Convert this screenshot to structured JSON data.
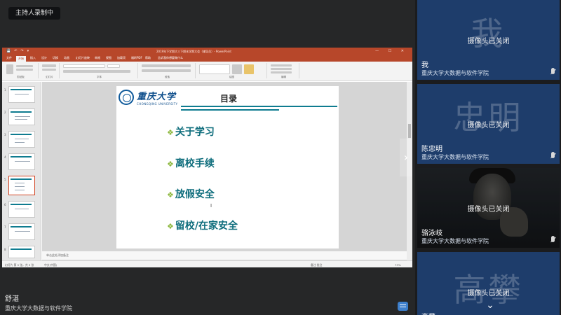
{
  "stage": {
    "recording_badge": "主持人录制中",
    "speaker_name": "舒湛",
    "speaker_org": "重庆大学大数据与软件学院"
  },
  "ppt": {
    "window_title": "2019年下学期大三下期末学期大会（辅导员）- PowerPoint",
    "window_controls": "— ☐ ✕",
    "menu_tabs": [
      "文件",
      "开始",
      "插入",
      "设计",
      "切换",
      "动画",
      "幻灯片放映",
      "审阅",
      "视图",
      "加载项",
      "福昕PDF",
      "帮助",
      "告诉我你想要做什么"
    ],
    "ribbon_groups": [
      "剪贴板",
      "幻灯片",
      "字体",
      "段落",
      "绘图",
      "编辑"
    ],
    "notes_placeholder": "单击此处添加备注",
    "status_left": "幻灯片 第 5 张，共 9 张",
    "status_lang": "中文(中国)",
    "status_right": "备注  批注",
    "zoom": "73%",
    "thumb_numbers": [
      "1",
      "2",
      "3",
      "4",
      "5",
      "6",
      "7",
      "8"
    ]
  },
  "slide": {
    "logo_cn": "重庆大学",
    "logo_en": "CHONGQING UNIVERSITY",
    "title": "目录",
    "bullet_glyph": "❖",
    "items": [
      "关于学习",
      "离校手续",
      "放假安全",
      "留校/在家安全"
    ]
  },
  "participants": [
    {
      "avatar_text": "我",
      "status": "摄像头已关闭",
      "name": "我",
      "org": "重庆大学大数据与软件学院"
    },
    {
      "avatar_text": "忠明",
      "status": "摄像头已关闭",
      "name": "陈忠明",
      "org": "重庆大学大数据与软件学院"
    },
    {
      "avatar_text": "",
      "status": "摄像头已关闭",
      "name": "骆泳岐",
      "org": "重庆大学大数据与软件学院"
    },
    {
      "avatar_text": "高攀",
      "status": "摄像头已关闭",
      "name": "高攀",
      "org": ""
    }
  ],
  "icons": {
    "next": "chevron-right-icon",
    "panel_scroll": "chevron-down-icon",
    "chat": "chat-icon",
    "mic": "mic-icon"
  },
  "colors": {
    "ppt_accent": "#b7472a",
    "tile_blue": "#1e3d6b",
    "slide_teal": "#0e6d7c",
    "bullet_green": "#8bb63b"
  }
}
